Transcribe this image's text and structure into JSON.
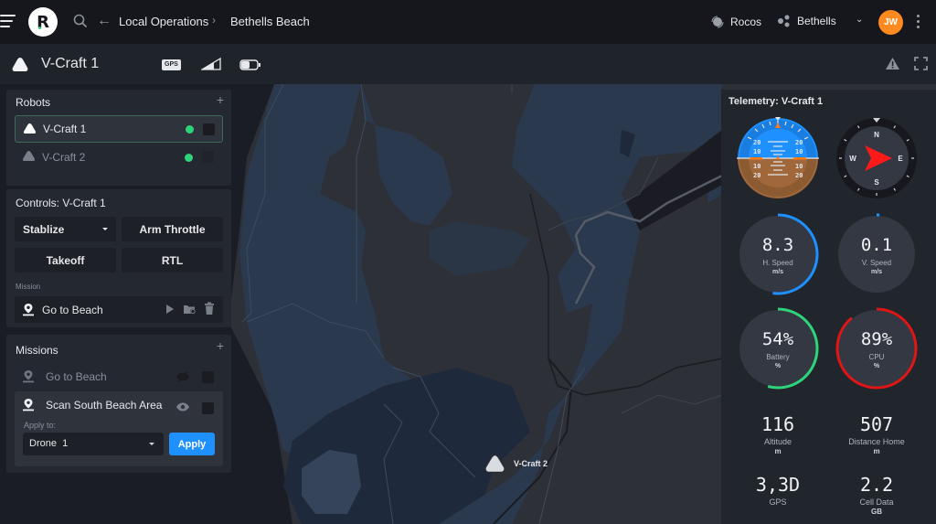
{
  "topbar": {
    "breadcrumb": [
      "Local Operations",
      "Bethells Beach"
    ],
    "org_name": "Rocos",
    "site_name": "Bethells",
    "user_initials": "JW",
    "logo_letter": "R",
    "colors": {
      "avatar": "#ff8a1f"
    }
  },
  "subheader": {
    "robot_name": "V-Craft 1",
    "gps_badge": "GPS",
    "icons": [
      "robot-icon",
      "gps-badge",
      "signal-icon",
      "battery-icon",
      "warning-icon",
      "fullscreen-icon"
    ]
  },
  "robots_panel": {
    "title": "Robots",
    "add_label": "+",
    "items": [
      {
        "name": "V-Craft 1",
        "status": "online",
        "selected": true,
        "checked": false
      },
      {
        "name": "V-Craft 2",
        "status": "online",
        "selected": false,
        "checked": false
      }
    ],
    "status_color": "#2ed47a"
  },
  "controls_panel": {
    "title": "Controls: V-Craft 1",
    "mode_select": "Stablize",
    "buttons": [
      "Arm Throttle",
      "Takeoff",
      "RTL"
    ],
    "mission_label": "Mission",
    "mission_name": "Go to Beach"
  },
  "missions_panel": {
    "title": "Missions",
    "add_label": "+",
    "items": [
      {
        "name": "Go to Beach",
        "visible": false,
        "checked": false
      },
      {
        "name": "Scan South Beach Area",
        "visible": true,
        "checked": false
      }
    ],
    "apply_to_label": "Apply to:",
    "apply_target": "Drone  1",
    "apply_button": "Apply",
    "accent": "#1e90ff"
  },
  "map": {
    "marker_label": "V-Craft 2"
  },
  "telemetry": {
    "title": "Telemetry: V-Craft 1",
    "attitude": {
      "pitch_labels": [
        "20",
        "10",
        "10",
        "20"
      ],
      "sky_color": "#1e90ff",
      "ground_color": "#a0683a"
    },
    "compass": {
      "labels": [
        "N",
        "E",
        "S",
        "W"
      ],
      "heading_deg": 90,
      "needle_color": "#ff1a1a"
    },
    "gauges": [
      {
        "id": "h-speed",
        "value": "8.3",
        "label": "H. Speed",
        "unit": "m/s",
        "fraction": 0.52,
        "color": "#1e90ff"
      },
      {
        "id": "v-speed",
        "value": "0.1",
        "label": "V. Speed",
        "unit": "m/s",
        "fraction": 0.01,
        "color": "#1e90ff"
      },
      {
        "id": "battery",
        "value": "54%",
        "label": "Battery",
        "unit": "%",
        "fraction": 0.54,
        "color": "#2ed47a"
      },
      {
        "id": "cpu",
        "value": "89%",
        "label": "CPU",
        "unit": "%",
        "fraction": 0.89,
        "color": "#e01515"
      }
    ],
    "stats": [
      {
        "id": "altitude",
        "value": "116",
        "label": "Altitude",
        "unit": "m"
      },
      {
        "id": "distance-home",
        "value": "507",
        "label": "Distance Home",
        "unit": "m"
      },
      {
        "id": "gps",
        "value": "3,3D",
        "label": "GPS",
        "unit": ""
      },
      {
        "id": "cell-data",
        "value": "2.2",
        "label": "Cell Data",
        "unit": "GB"
      }
    ]
  }
}
